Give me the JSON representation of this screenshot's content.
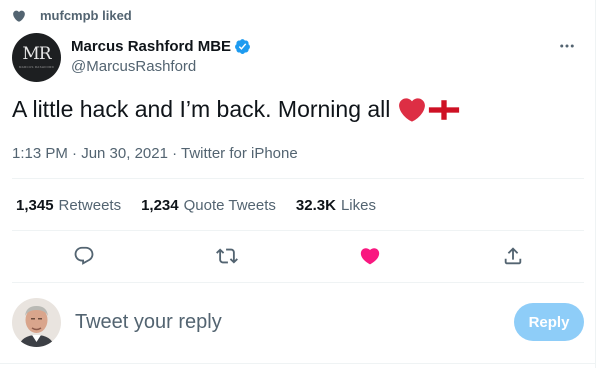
{
  "social_context": {
    "icon": "heart-icon",
    "text": "mufcmpb liked"
  },
  "author": {
    "avatar_monogram": "MR",
    "avatar_caption": "MARCUS RASHFORD",
    "display_name": "Marcus Rashford MBE",
    "verified": true,
    "handle": "@MarcusRashford"
  },
  "tweet": {
    "text": "A little hack and I’m back. Morning all",
    "emojis": [
      "red-heart",
      "england-flag"
    ],
    "timestamp": "1:13 PM · Jun 30, 2021 · Twitter for iPhone"
  },
  "stats": {
    "retweets_count": "1,345",
    "retweets_label": "Retweets",
    "quotes_count": "1,234",
    "quotes_label": "Quote Tweets",
    "likes_count": "32.3K",
    "likes_label": "Likes"
  },
  "actions": {
    "reply_icon": "reply-icon",
    "retweet_icon": "retweet-icon",
    "like_icon": "like-icon",
    "share_icon": "share-icon",
    "liked": true
  },
  "reply_box": {
    "placeholder": "Tweet your reply",
    "button_label": "Reply"
  },
  "colors": {
    "like_red": "#f91880",
    "verified_blue": "#1d9bf0",
    "reply_button_disabled": "#8ecdf8",
    "secondary_text": "#536471"
  }
}
